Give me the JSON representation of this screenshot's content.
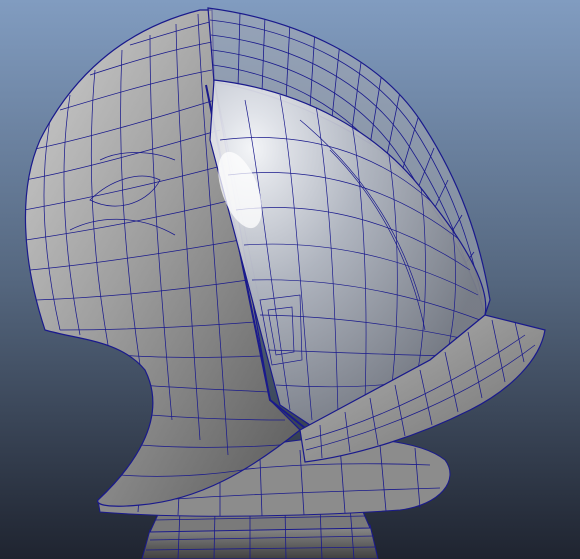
{
  "viewport": {
    "panel": "3d-modeling-viewport",
    "subject": "helmet-wireframe-model",
    "display_mode": "smooth-shade-with-wireframe-on-shaded",
    "colors": {
      "background_top": "#7f9bbf",
      "background_mid": "#53667e",
      "background_bottom": "#1f2430",
      "surface_light": "#cfcfcf",
      "surface_mid": "#9a9a9a",
      "surface_dark": "#505050",
      "wire": "#1a1a8c",
      "visor_tint": "#b9bdc6"
    }
  }
}
